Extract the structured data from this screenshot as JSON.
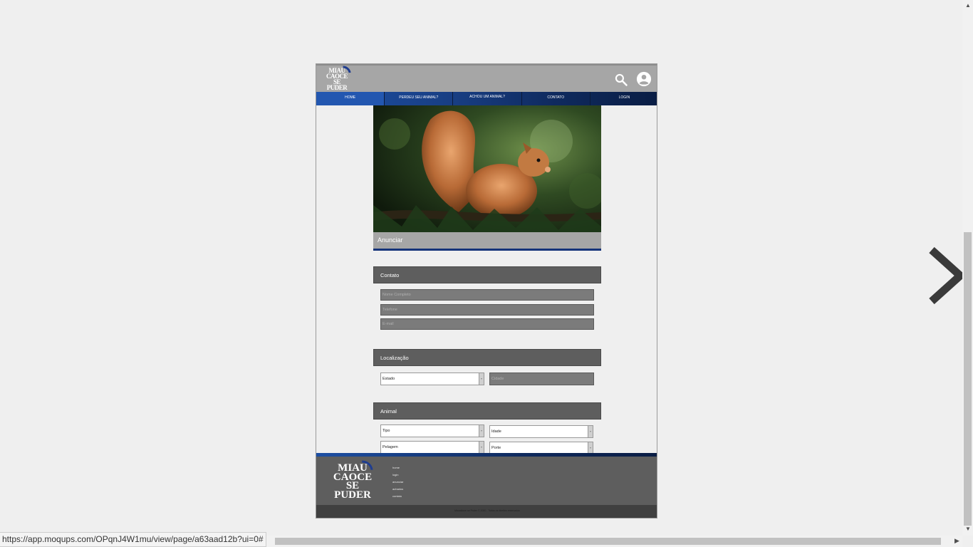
{
  "header": {
    "logo_lines": [
      "MIAU",
      "CAOCE",
      "SE",
      "PUDER"
    ]
  },
  "nav": {
    "items": [
      {
        "label": "HOME"
      },
      {
        "label": "PERDEU SEU ANIMAL?"
      },
      {
        "label": "ACHOU UM ANIMAL?"
      },
      {
        "label": "CONTATO"
      },
      {
        "label": "LOGIN"
      }
    ]
  },
  "banner": {
    "label": "Anunciar"
  },
  "sections": {
    "contato": {
      "title": "Contato",
      "name_placeholder": "Nome Completo",
      "phone_placeholder": "Telefone",
      "email_placeholder": "E-mail"
    },
    "localizacao": {
      "title": "Localização",
      "estado_value": "Estado",
      "cidade_placeholder": "Cidade"
    },
    "animal": {
      "title": "Animal",
      "tipo_value": "Tipo",
      "idade_value": "Idade",
      "pelagem_value": "Pelagem",
      "porte_value": "Porte"
    }
  },
  "footer": {
    "logo_lines": [
      "MIAU",
      "CAOCE",
      "SE",
      "PUDER"
    ],
    "links": [
      "home",
      "login",
      "anunciar",
      "achados",
      "contato"
    ],
    "copyright": "Miaucãoce se Puder © 2020 - Todos os direitos reservados"
  },
  "browser": {
    "status_url": "https://app.moqups.com/OPqnJ4W1mu/view/page/a63aad12b?ui=0#"
  },
  "colors": {
    "nav_blue": "#1d4fa3",
    "section_gray": "#5e5e5e",
    "topbar_gray": "#a6a6a6"
  },
  "icons": [
    "search-icon",
    "account-icon",
    "chevron-right-icon"
  ]
}
